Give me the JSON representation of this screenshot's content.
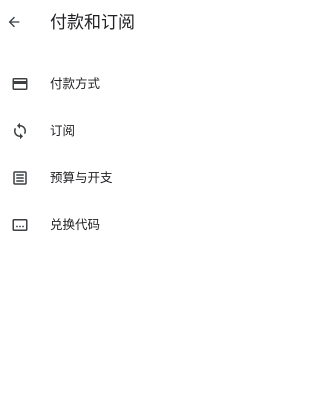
{
  "header": {
    "back_icon": "arrow-back-icon",
    "title": "付款和订阅"
  },
  "menu": {
    "items": [
      {
        "icon": "credit-card-icon",
        "label": "付款方式"
      },
      {
        "icon": "sync-icon",
        "label": "订阅"
      },
      {
        "icon": "receipt-icon",
        "label": "预算与开支"
      },
      {
        "icon": "redeem-code-icon",
        "label": "兑换代码"
      }
    ]
  },
  "colors": {
    "background": "#ffffff",
    "text": "#202124",
    "icon": "#3c4043"
  }
}
